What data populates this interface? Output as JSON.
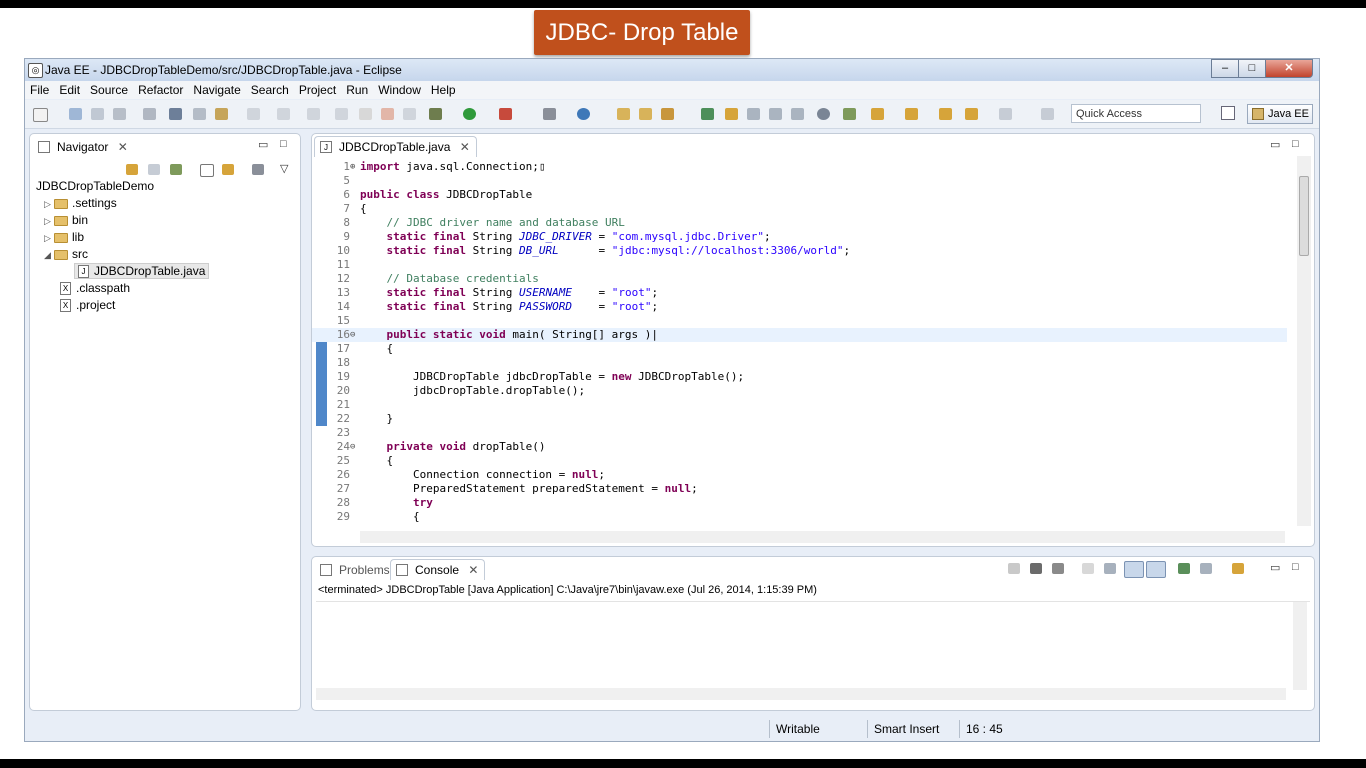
{
  "slide_title": "JDBC- Drop Table",
  "window": {
    "title": "Java EE - JDBCDropTableDemo/src/JDBCDropTable.java - Eclipse",
    "minimize": "–",
    "maximize": "□",
    "close": "✕"
  },
  "menu": [
    "File",
    "Edit",
    "Source",
    "Refactor",
    "Navigate",
    "Search",
    "Project",
    "Run",
    "Window",
    "Help"
  ],
  "toolbar": {
    "quick_access_placeholder": "Quick Access",
    "perspective_label": "Java EE"
  },
  "navigator": {
    "tab_label": "Navigator",
    "project": "JDBCDropTableDemo",
    "items": [
      {
        "label": ".settings",
        "kind": "folder",
        "expand": "▷"
      },
      {
        "label": "bin",
        "kind": "folder",
        "expand": "▷"
      },
      {
        "label": "lib",
        "kind": "folder",
        "expand": "▷"
      },
      {
        "label": "src",
        "kind": "folder",
        "expand": "◢"
      },
      {
        "label": "JDBCDropTable.java",
        "kind": "java"
      },
      {
        "label": ".classpath",
        "kind": "xml"
      },
      {
        "label": ".project",
        "kind": "xml"
      }
    ]
  },
  "editor": {
    "tab_label": "JDBCDropTable.java",
    "lines": [
      {
        "n": "1",
        "fold": "⊕",
        "html": "<span class='k'>import</span> java.sql.Connection;▯"
      },
      {
        "n": "5",
        "html": ""
      },
      {
        "n": "6",
        "html": "<span class='k'>public class</span> JDBCDropTable"
      },
      {
        "n": "7",
        "html": "{"
      },
      {
        "n": "8",
        "html": "    <span class='c'>// JDBC driver name and database URL</span>"
      },
      {
        "n": "9",
        "html": "    <span class='k'>static final</span> String <span class='f'>JDBC_DRIVER</span> = <span class='s'>\"com.mysql.jdbc.Driver\"</span>;"
      },
      {
        "n": "10",
        "html": "    <span class='k'>static final</span> String <span class='f'>DB_URL</span>      = <span class='s'>\"jdbc:mysql://localhost:3306/world\"</span>;"
      },
      {
        "n": "11",
        "html": ""
      },
      {
        "n": "12",
        "html": "    <span class='c'>// Database credentials</span>"
      },
      {
        "n": "13",
        "html": "    <span class='k'>static final</span> String <span class='f'>USERNAME</span>    = <span class='s'>\"root\"</span>;"
      },
      {
        "n": "14",
        "html": "    <span class='k'>static final</span> String <span class='f'>PASSWORD</span>    = <span class='s'>\"root\"</span>;"
      },
      {
        "n": "15",
        "html": ""
      },
      {
        "n": "16",
        "fold": "⊖",
        "hl": true,
        "html": "    <span class='k'>public static void</span> main( String[] args )|"
      },
      {
        "n": "17",
        "html": "    {"
      },
      {
        "n": "18",
        "html": ""
      },
      {
        "n": "19",
        "html": "        JDBCDropTable jdbcDropTable = <span class='k'>new</span> JDBCDropTable();"
      },
      {
        "n": "20",
        "html": "        jdbcDropTable.dropTable();"
      },
      {
        "n": "21",
        "html": ""
      },
      {
        "n": "22",
        "html": "    }"
      },
      {
        "n": "23",
        "html": ""
      },
      {
        "n": "24",
        "fold": "⊖",
        "html": "    <span class='k'>private void</span> dropTable()"
      },
      {
        "n": "25",
        "html": "    {"
      },
      {
        "n": "26",
        "html": "        Connection connection = <span class='k'>null</span>;"
      },
      {
        "n": "27",
        "html": "        PreparedStatement preparedStatement = <span class='k'>null</span>;"
      },
      {
        "n": "28",
        "html": "        <span class='k'>try</span>"
      },
      {
        "n": "29",
        "html": "        {"
      }
    ]
  },
  "console": {
    "problems_label": "Problems",
    "console_label": "Console",
    "description": "<terminated> JDBCDropTable [Java Application] C:\\Java\\jre7\\bin\\javaw.exe (Jul 26, 2014, 1:15:39 PM)"
  },
  "status": {
    "writable": "Writable",
    "insert_mode": "Smart Insert",
    "position": "16 : 45"
  }
}
